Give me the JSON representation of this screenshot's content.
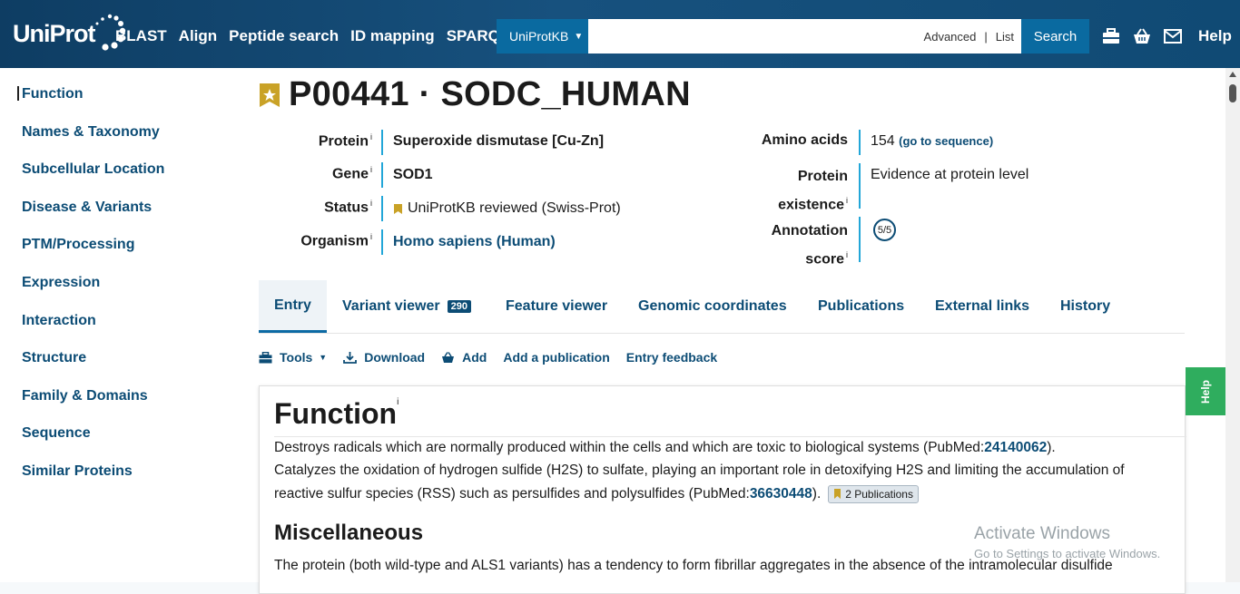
{
  "header": {
    "logo": "UniProt",
    "nav": [
      "BLAST",
      "Align",
      "Peptide search",
      "ID mapping",
      "SPARQL"
    ],
    "db_select": "UniProtKB",
    "search_placeholder": "",
    "advanced": "Advanced",
    "list": "List",
    "search_button": "Search",
    "help": "Help",
    "icons": [
      "toolbox-icon",
      "basket-icon",
      "mail-icon"
    ]
  },
  "sidebar": {
    "items": [
      "Function",
      "Names & Taxonomy",
      "Subcellular Location",
      "Disease & Variants",
      "PTM/Processing",
      "Expression",
      "Interaction",
      "Structure",
      "Family & Domains",
      "Sequence",
      "Similar Proteins"
    ]
  },
  "entry": {
    "title": "P00441 · SODC_HUMAN",
    "info_marker": "i",
    "protein_label": "Protein",
    "protein_value": "Superoxide dismutase [Cu-Zn]",
    "gene_label": "Gene",
    "gene_value": "SOD1",
    "status_label": "Status",
    "status_value": "UniProtKB reviewed (Swiss-Prot)",
    "organism_label": "Organism",
    "organism_value": "Homo sapiens (Human)",
    "amino_label": "Amino acids",
    "amino_value": "154",
    "amino_link": "(go to sequence)",
    "existence_label_1": "Protein",
    "existence_label_2": "existence",
    "existence_value": "Evidence at protein level",
    "score_label_1": "Annotation",
    "score_label_2": "score",
    "score_value": "5/5"
  },
  "tabs": {
    "entry": "Entry",
    "variant": "Variant viewer",
    "variant_count": "290",
    "feature": "Feature viewer",
    "genomic": "Genomic coordinates",
    "publications": "Publications",
    "external": "External links",
    "history": "History"
  },
  "toolbar": {
    "tools": "Tools",
    "download": "Download",
    "add": "Add",
    "add_pub": "Add a publication",
    "feedback": "Entry feedback"
  },
  "function": {
    "heading": "Function",
    "p1_text": "Destroys radicals which are normally produced within the cells and which are toxic to biological systems (PubMed:",
    "p1_pm": "24140062",
    "p1_end": ").",
    "p2_line1": "Catalyzes the oxidation of hydrogen sulfide (H2S) to sulfate, playing an important role in detoxifying H2S and limiting the accumulation of",
    "p2_line2": "reactive sulfur species (RSS) such as persulfides and polysulfides (PubMed:",
    "p2_pm": "36630448",
    "p2_end": ").",
    "pub_badge": "2 Publications",
    "misc_heading": "Miscellaneous",
    "misc_text": "The protein (both wild-type and ALS1 variants) has a tendency to form fibrillar aggregates in the absence of the intramolecular disulfide"
  },
  "help_tab": "Help",
  "watermark": {
    "line1": "Activate Windows",
    "line2": "Go to Settings to activate Windows."
  }
}
